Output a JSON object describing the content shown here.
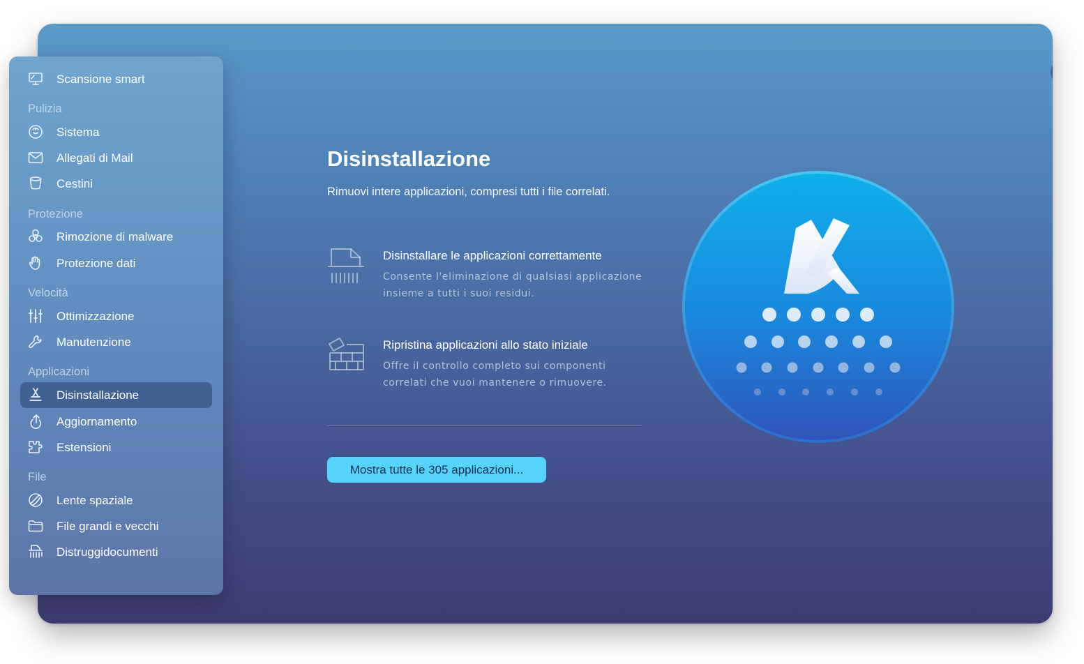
{
  "sidebar": {
    "smart_scan": {
      "label": "Scansione smart",
      "icon": "monitor-icon"
    },
    "sections": [
      {
        "title": "Pulizia",
        "items": [
          {
            "label": "Sistema",
            "icon": "system-junk-icon"
          },
          {
            "label": "Allegati di Mail",
            "icon": "envelope-icon"
          },
          {
            "label": "Cestini",
            "icon": "trash-bin-icon"
          }
        ]
      },
      {
        "title": "Protezione",
        "items": [
          {
            "label": "Rimozione di malware",
            "icon": "biohazard-icon"
          },
          {
            "label": "Protezione dati",
            "icon": "hand-icon"
          }
        ]
      },
      {
        "title": "Velocità",
        "items": [
          {
            "label": "Ottimizzazione",
            "icon": "sliders-icon"
          },
          {
            "label": "Manutenzione",
            "icon": "wrench-icon"
          }
        ]
      },
      {
        "title": "Applicazioni",
        "items": [
          {
            "label": "Disinstallazione",
            "icon": "uninstaller-icon",
            "active": true
          },
          {
            "label": "Aggiornamento",
            "icon": "updater-icon"
          },
          {
            "label": "Estensioni",
            "icon": "extensions-icon"
          }
        ]
      },
      {
        "title": "File",
        "items": [
          {
            "label": "Lente spaziale",
            "icon": "space-lens-icon"
          },
          {
            "label": "File grandi e vecchi",
            "icon": "folder-icon"
          },
          {
            "label": "Distruggidocumenti",
            "icon": "shredder-icon"
          }
        ]
      }
    ]
  },
  "main": {
    "title": "Disinstallazione",
    "subtitle": "Rimuovi intere applicazioni, compresi tutti i file correlati.",
    "features": [
      {
        "title": "Disinstallare le applicazioni correttamente",
        "description": "Consente l'eliminazione di qualsiasi applicazione insieme a tutti i suoi residui.",
        "icon": "shredded-document-icon"
      },
      {
        "title": "Ripristina applicazioni allo stato iniziale",
        "description": "Offre il controllo completo sui componenti correlati che vuoi mantenere o rimuovere.",
        "icon": "reset-bricks-icon"
      }
    ],
    "cta_label": "Mostra tutte le 305 applicazioni..."
  },
  "colors": {
    "accent": "#55d3fb",
    "hero_blue": "#1e86dc",
    "sidebar_active": "#2a4274"
  }
}
